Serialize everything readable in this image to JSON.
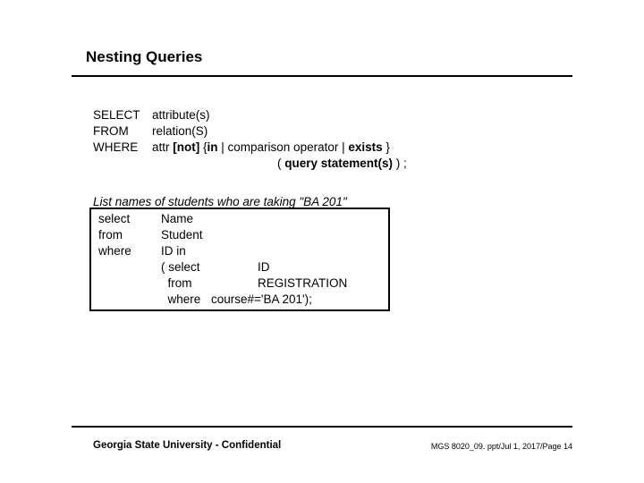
{
  "title": "Nesting Queries",
  "syntax": {
    "select_kw": "SELECT",
    "select_val": "attribute(s)",
    "from_kw": "FROM",
    "from_val": "relation(S)",
    "where_kw": "WHERE",
    "where_val_pre": "attr ",
    "where_not": "[not]",
    "where_val_mid1": " {",
    "where_in": "in",
    "where_val_mid2": " | comparison operator | ",
    "where_exists": "exists",
    "where_val_post": " }",
    "query_stmt_pre": "( ",
    "query_stmt_bold": "query statement(s)",
    "query_stmt_post": " ) ;"
  },
  "prompt": "List names of students who are taking \"BA 201\"",
  "example": {
    "select_kw": "select",
    "select_val": "Name",
    "from_kw": "from",
    "from_val": "Student",
    "where_kw": "where",
    "where_val": "ID in",
    "sub_select_kw": "( select",
    "sub_select_val": "ID",
    "sub_from_kw": "  from",
    "sub_from_val": "REGISTRATION",
    "sub_where_kw": "  where",
    "sub_where_val": "course#='BA 201');"
  },
  "footer": {
    "left": "Georgia State University - Confidential",
    "right": "MGS 8020_09. ppt/Jul 1, 2017/Page 14"
  }
}
